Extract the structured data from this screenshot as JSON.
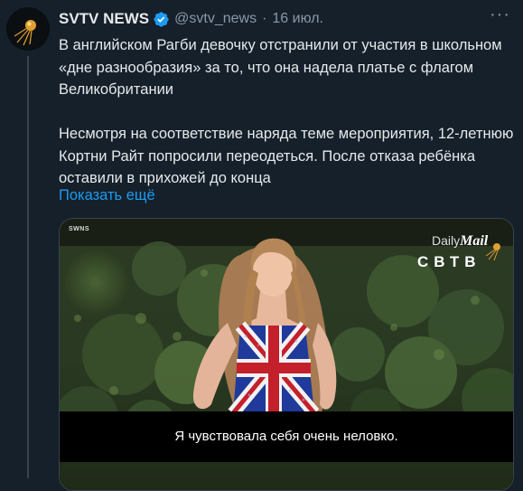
{
  "tweet": {
    "author_name": "SVTV NEWS",
    "handle": "@svtv_news",
    "separator": "·",
    "date": "16 июл.",
    "more": "···",
    "paragraphs": [
      "В английском Рагби девочку отстранили от участия в школьном «дне разнообразия» за то, что она надела платье с флагом Великобритании",
      "Несмотря на соответствие наряда теме мероприятия, 12-летнюю Кортни Райт попросили переодеться. После отказа ребёнка оставили в прихожей до конца"
    ],
    "show_more": "Показать ещё"
  },
  "media": {
    "watermark_source": "SWNS",
    "dailymail_daily": "Daily",
    "dailymail_mail": "Mail",
    "channel_logo": "СВТВ",
    "subtitle": "Я чувствовала себя очень неловко."
  },
  "colors": {
    "background": "#15202b",
    "text": "#e7e9ea",
    "secondary": "#8b98a5",
    "link": "#1d9bf0",
    "verified": "#1d9bf0"
  },
  "icons": {
    "avatar": "sputnik-logo-icon",
    "verified": "verified-badge-icon",
    "more": "more-options-icon"
  }
}
